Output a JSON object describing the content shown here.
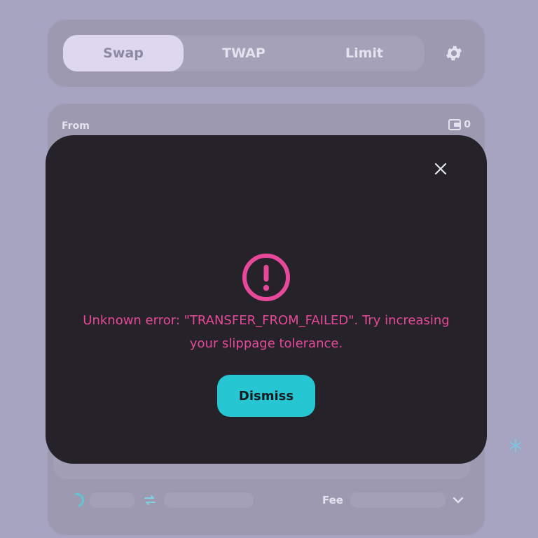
{
  "tabs": [
    {
      "label": "Swap",
      "active": true
    },
    {
      "label": "TWAP",
      "active": false
    },
    {
      "label": "Limit",
      "active": false
    }
  ],
  "from_label": "From",
  "balance": "0",
  "fee_label": "Fee",
  "modal": {
    "error_message": "Unknown error: \"TRANSFER_FROM_FAILED\". Try increasing your slippage tolerance.",
    "dismiss_label": "Dismiss"
  },
  "icons": [
    "gear-icon",
    "wallet-icon",
    "close-icon",
    "error-icon",
    "loading-spinner-icon",
    "swap-arrows-icon",
    "chevron-down-icon",
    "snowflake-icon"
  ],
  "colors": {
    "background": "#a7a4c2",
    "modal": "#252329",
    "error": "#e8489a",
    "accent": "#26c6d2"
  }
}
